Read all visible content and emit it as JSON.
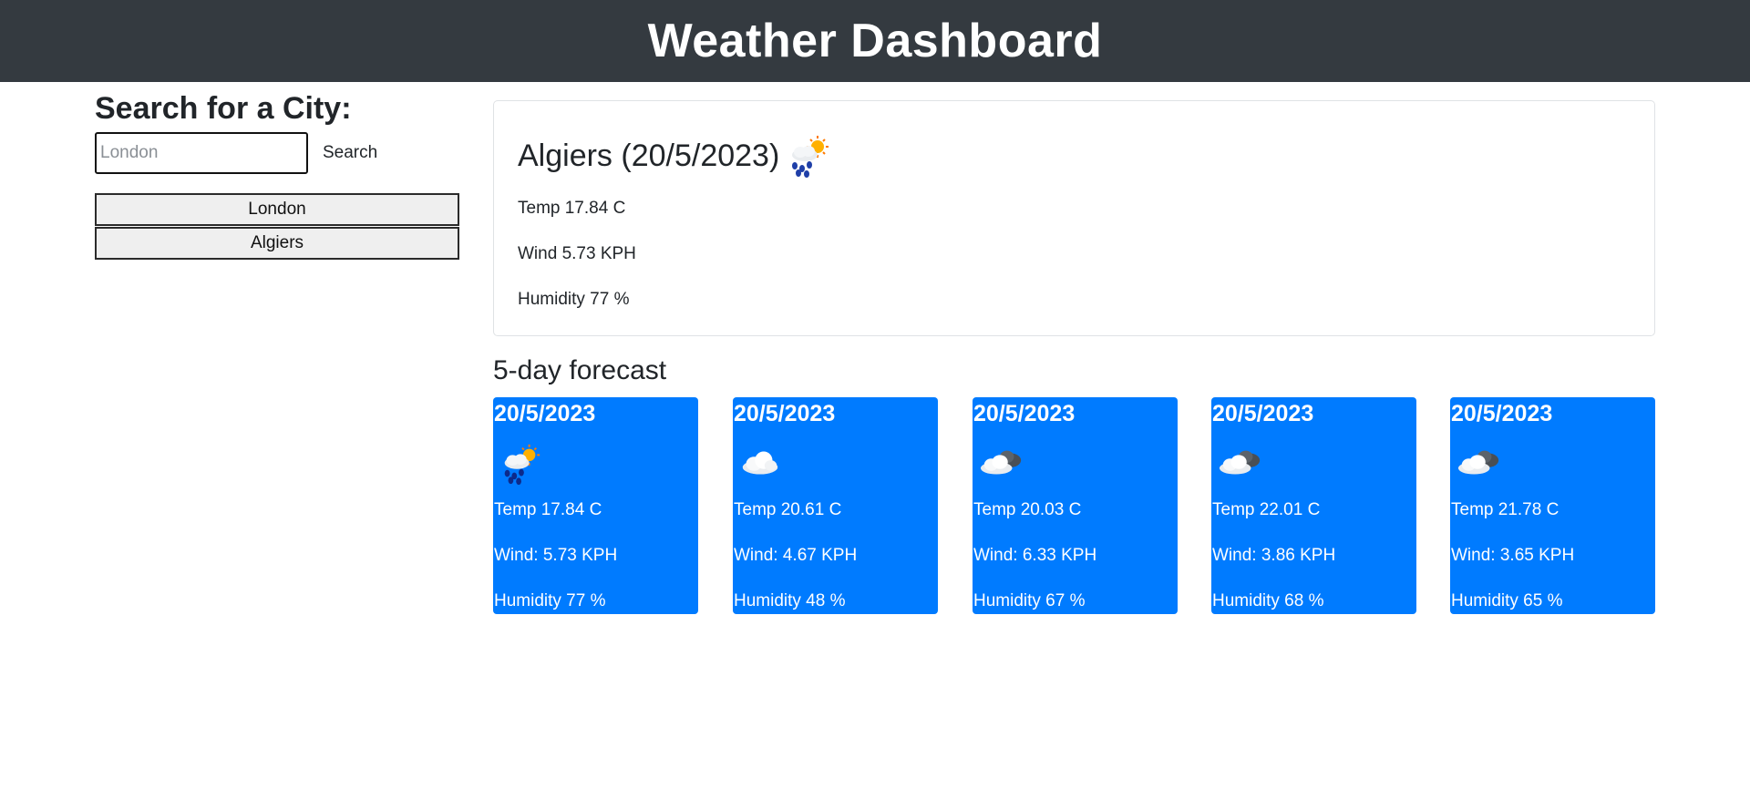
{
  "header": {
    "title": "Weather Dashboard"
  },
  "search": {
    "heading": "Search for a City:",
    "placeholder": "London",
    "value": "",
    "button_label": "Search"
  },
  "history": [
    {
      "label": "London"
    },
    {
      "label": "Algiers"
    }
  ],
  "current": {
    "title": "Algiers (20/5/2023)",
    "icon": "rain-sun-icon",
    "temp": "Temp 17.84 C",
    "wind": "Wind 5.73 KPH",
    "humidity": "Humidity 77 %"
  },
  "forecast": {
    "heading": "5-day forecast",
    "days": [
      {
        "date": "20/5/2023",
        "icon": "rain-sun-icon",
        "temp": "Temp 17.84 C",
        "wind": "Wind: 5.73 KPH",
        "humidity": "Humidity 77 %"
      },
      {
        "date": "20/5/2023",
        "icon": "cloud-icon",
        "temp": "Temp 20.61 C",
        "wind": "Wind: 4.67 KPH",
        "humidity": "Humidity 48 %"
      },
      {
        "date": "20/5/2023",
        "icon": "dark-cloud-icon",
        "temp": "Temp 20.03 C",
        "wind": "Wind: 6.33 KPH",
        "humidity": "Humidity 67 %"
      },
      {
        "date": "20/5/2023",
        "icon": "dark-cloud-icon",
        "temp": "Temp 22.01 C",
        "wind": "Wind: 3.86 KPH",
        "humidity": "Humidity 68 %"
      },
      {
        "date": "20/5/2023",
        "icon": "dark-cloud-icon",
        "temp": "Temp 21.78 C",
        "wind": "Wind: 3.65 KPH",
        "humidity": "Humidity 65 %"
      }
    ]
  }
}
